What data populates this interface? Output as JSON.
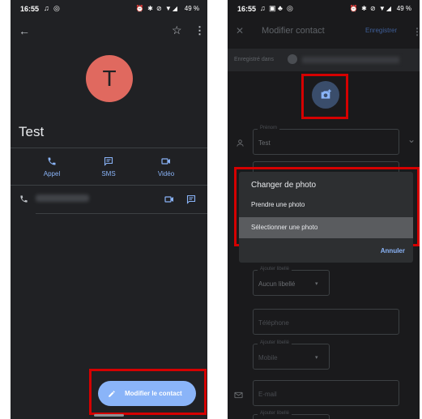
{
  "left": {
    "status_time": "16:55",
    "status_battery": "49 %",
    "avatar_letter": "T",
    "contact_name": "Test",
    "actions": [
      {
        "label": "Appel",
        "icon": "phone-icon"
      },
      {
        "label": "SMS",
        "icon": "message-icon"
      },
      {
        "label": "Vidéo",
        "icon": "video-icon"
      }
    ],
    "edit_button_label": "Modifier le contact",
    "colors": {
      "background": "#202124",
      "accent": "#8ab4f8",
      "avatar": "#e0695f",
      "highlight": "#d50000"
    }
  },
  "right": {
    "status_time": "16:55",
    "status_battery": "49 %",
    "title": "Modifier contact",
    "save_label": "Enregistrer",
    "saved_in_label": "Enregistré dans",
    "first_name_label": "Prénom",
    "first_name_value": "Test",
    "dialog": {
      "title": "Changer de photo",
      "options": [
        "Prendre une photo",
        "Sélectionner une photo"
      ],
      "cancel": "Annuler"
    },
    "label_field_label": "Ajouter libellé",
    "label_field_value": "Aucun libellé",
    "phone_placeholder": "Téléphone",
    "phone_type_label": "Ajouter libellé",
    "phone_type_value": "Mobile",
    "email_placeholder": "E-mail",
    "email_type_label": "Ajouter libellé",
    "colors": {
      "background": "#1a1a1c",
      "dialog": "#2d2f31",
      "selected_option": "#5a5c5f",
      "highlight": "#d50000"
    }
  }
}
